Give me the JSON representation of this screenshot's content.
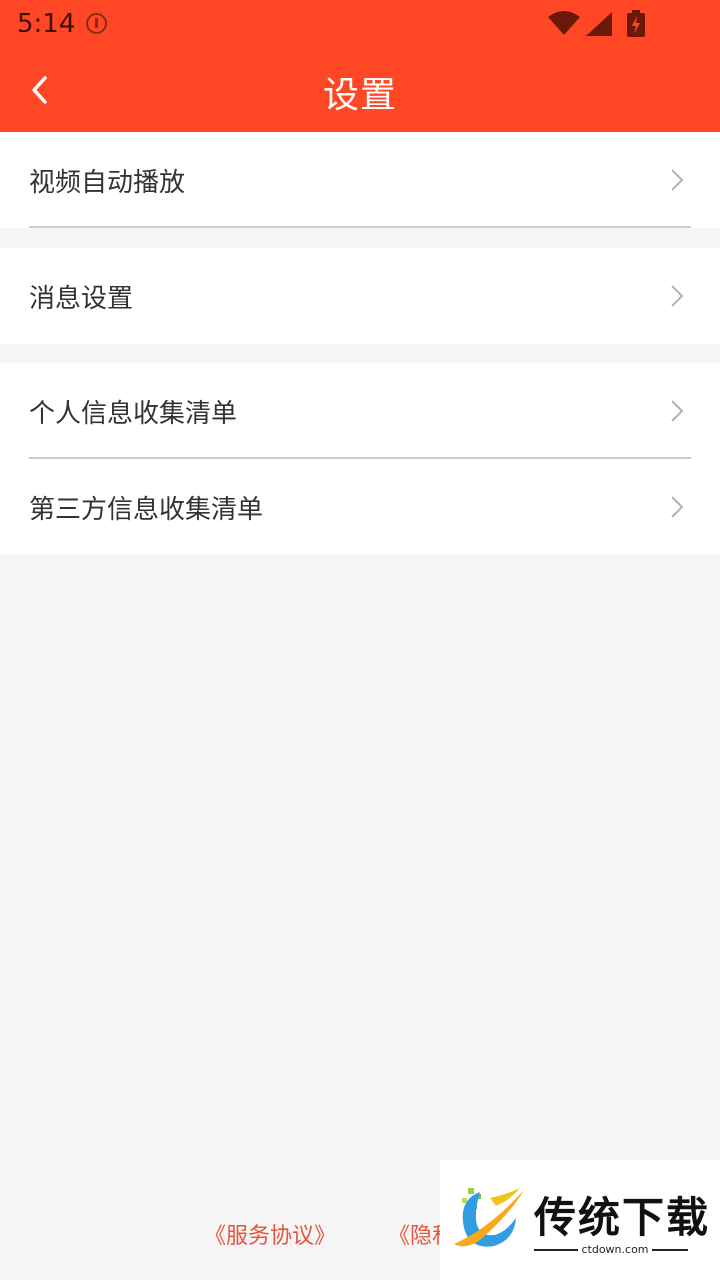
{
  "status_bar": {
    "time": "5:14",
    "icons": [
      "alert-icon",
      "wifi-icon",
      "signal-icon",
      "battery-charging-icon"
    ]
  },
  "header": {
    "title": "设置",
    "back_icon": "chevron-left-icon",
    "background": "#ff4726"
  },
  "groups": [
    {
      "items": [
        {
          "label": "视频自动播放"
        }
      ]
    },
    {
      "items": [
        {
          "label": "消息设置"
        }
      ]
    },
    {
      "items": [
        {
          "label": "个人信息收集清单"
        },
        {
          "label": "第三方信息收集清单"
        }
      ]
    }
  ],
  "footer": {
    "service_agreement": "《服务协议》",
    "privacy_policy_partial": "《隐私"
  },
  "watermark": {
    "brand": "传统下载",
    "domain": "ctdown.com"
  },
  "colors": {
    "accent": "#ff4726",
    "link": "#e8533a",
    "text": "#333333",
    "background": "#f5f5f5"
  }
}
